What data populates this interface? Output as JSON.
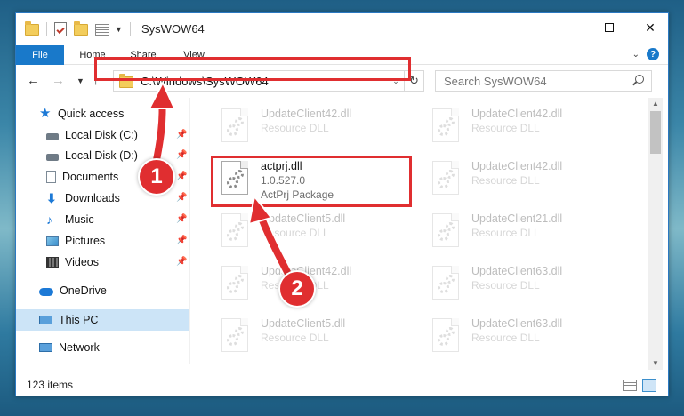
{
  "window": {
    "title": "SysWOW64"
  },
  "ribbon": {
    "tabs": [
      {
        "label": "File"
      },
      {
        "label": "Home"
      },
      {
        "label": "Share"
      },
      {
        "label": "View"
      }
    ],
    "help": "?"
  },
  "navbar": {
    "address": "C:\\Windows\\SysWOW64",
    "search_placeholder": "Search SysWOW64"
  },
  "sidebar": {
    "items": [
      {
        "label": "Quick access",
        "icon": "star-icon"
      },
      {
        "label": "Local Disk (C:)",
        "icon": "disk-icon",
        "pinned": true
      },
      {
        "label": "Local Disk (D:)",
        "icon": "disk-icon",
        "pinned": true
      },
      {
        "label": "Documents",
        "icon": "documents-icon",
        "pinned": true
      },
      {
        "label": "Downloads",
        "icon": "downloads-icon",
        "pinned": true
      },
      {
        "label": "Music",
        "icon": "music-icon",
        "pinned": true
      },
      {
        "label": "Pictures",
        "icon": "pictures-icon",
        "pinned": true
      },
      {
        "label": "Videos",
        "icon": "videos-icon",
        "pinned": true
      },
      {
        "label": "OneDrive",
        "icon": "onedrive-icon"
      },
      {
        "label": "This PC",
        "icon": "this-pc-icon",
        "selected": true
      },
      {
        "label": "Network",
        "icon": "network-icon"
      }
    ]
  },
  "files": [
    {
      "name": "UpdateClient42.dll",
      "type": "Resource DLL",
      "faded": true
    },
    {
      "name": "UpdateClient42.dll",
      "type": "Resource DLL",
      "faded": true
    },
    {
      "name": "actprj.dll",
      "version": "1.0.527.0",
      "type": "ActPrj Package",
      "faded": false,
      "highlighted": true
    },
    {
      "name": "UpdateClient42.dll",
      "type": "Resource DLL",
      "faded": true
    },
    {
      "name": "UpdateClient5.dll",
      "type": "Resource DLL",
      "faded": true
    },
    {
      "name": "UpdateClient21.dll",
      "type": "Resource DLL",
      "faded": true
    },
    {
      "name": "UpdateClient42.dll",
      "type": "Resource DLL",
      "faded": true
    },
    {
      "name": "UpdateClient63.dll",
      "type": "Resource DLL",
      "faded": true
    },
    {
      "name": "UpdateClient5.dll",
      "type": "Resource DLL",
      "faded": true
    },
    {
      "name": "UpdateClient63.dll",
      "type": "Resource DLL",
      "faded": true
    }
  ],
  "status": {
    "count": "123 items"
  },
  "annotations": {
    "step1": "1",
    "step2": "2",
    "color": "#e02e30"
  }
}
